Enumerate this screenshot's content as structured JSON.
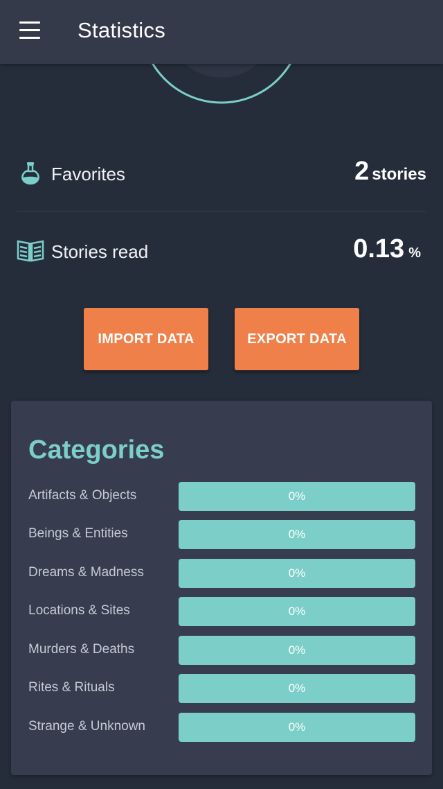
{
  "appbar": {
    "title": "Statistics",
    "menu_icon": "hamburger-menu-icon"
  },
  "colors": {
    "background": "#252d3b",
    "appbar": "#343a4a",
    "card": "#373d4e",
    "accent": "#7ccfc8",
    "button": "#f0804a"
  },
  "progress_ring": {
    "color": "#7ccfc8"
  },
  "stats": {
    "favorites": {
      "icon": "potion-flask-icon",
      "label": "Favorites",
      "value": "2",
      "unit": "stories"
    },
    "stories_read": {
      "icon": "open-book-icon",
      "label": "Stories read",
      "value": "0.13",
      "unit": "%"
    }
  },
  "buttons": {
    "import_label": "IMPORT DATA",
    "export_label": "EXPORT DATA"
  },
  "categories": {
    "title": "Categories",
    "items": [
      {
        "label": "Artifacts & Objects",
        "percent": 0,
        "percent_text": "0%"
      },
      {
        "label": "Beings & Entities",
        "percent": 0,
        "percent_text": "0%"
      },
      {
        "label": "Dreams & Madness",
        "percent": 0,
        "percent_text": "0%"
      },
      {
        "label": "Locations & Sites",
        "percent": 0,
        "percent_text": "0%"
      },
      {
        "label": "Murders & Deaths",
        "percent": 0,
        "percent_text": "0%"
      },
      {
        "label": "Rites & Rituals",
        "percent": 0,
        "percent_text": "0%"
      },
      {
        "label": "Strange & Unknown",
        "percent": 0,
        "percent_text": "0%"
      }
    ]
  }
}
